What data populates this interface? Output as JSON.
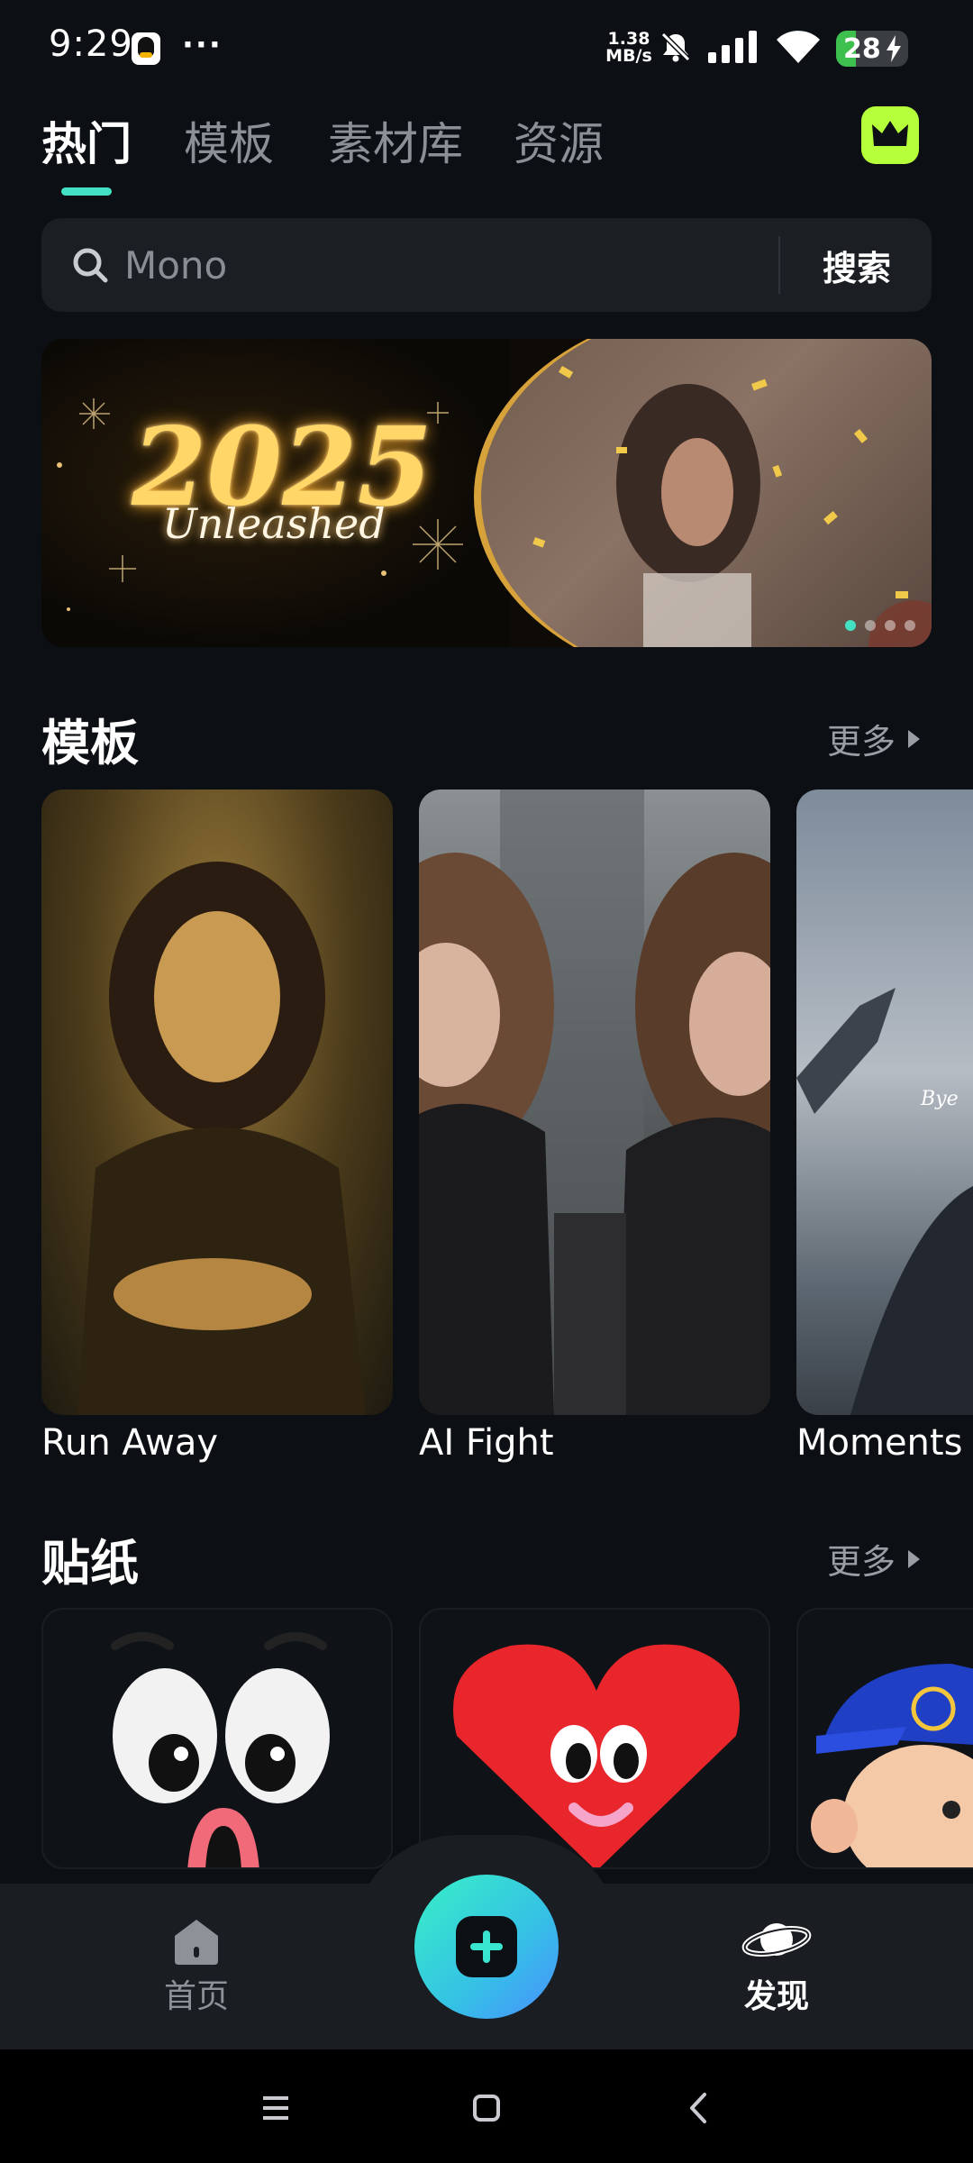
{
  "status_bar": {
    "time": "9:29",
    "more": "···",
    "net_speed_value": "1.38",
    "net_speed_unit": "MB/s",
    "battery_level": "28",
    "battery_fraction": 0.28,
    "icons": [
      "qq-icon",
      "bell-off-icon",
      "signal-icon",
      "wifi-icon",
      "battery-charging-icon"
    ]
  },
  "tabs": [
    {
      "label": "热门",
      "active": true
    },
    {
      "label": "模板",
      "active": false
    },
    {
      "label": "素材库",
      "active": false
    },
    {
      "label": "资源",
      "active": false
    }
  ],
  "premium": {
    "icon": "crown-icon",
    "color": "#b6ff3b"
  },
  "search": {
    "placeholder": "Mono",
    "button_label": "搜索"
  },
  "banner": {
    "year": "2025",
    "subtitle": "Unleashed",
    "slides": 4,
    "active_slide": 1
  },
  "templates": {
    "title": "模板",
    "more_label": "更多",
    "items": [
      {
        "label": "Run Away"
      },
      {
        "label": "AI Fight"
      },
      {
        "label": "Moments o"
      }
    ]
  },
  "stickers": {
    "title": "贴纸",
    "more_label": "更多",
    "items": [
      "eyes-sticker",
      "heart-sticker",
      "cap-sticker"
    ]
  },
  "bottom_nav": {
    "home_label": "首页",
    "discover_label": "发现",
    "create_icon": "plus-icon",
    "active": "发现"
  },
  "theme": {
    "accent": "#43e0c3",
    "background": "#0c0f13"
  }
}
